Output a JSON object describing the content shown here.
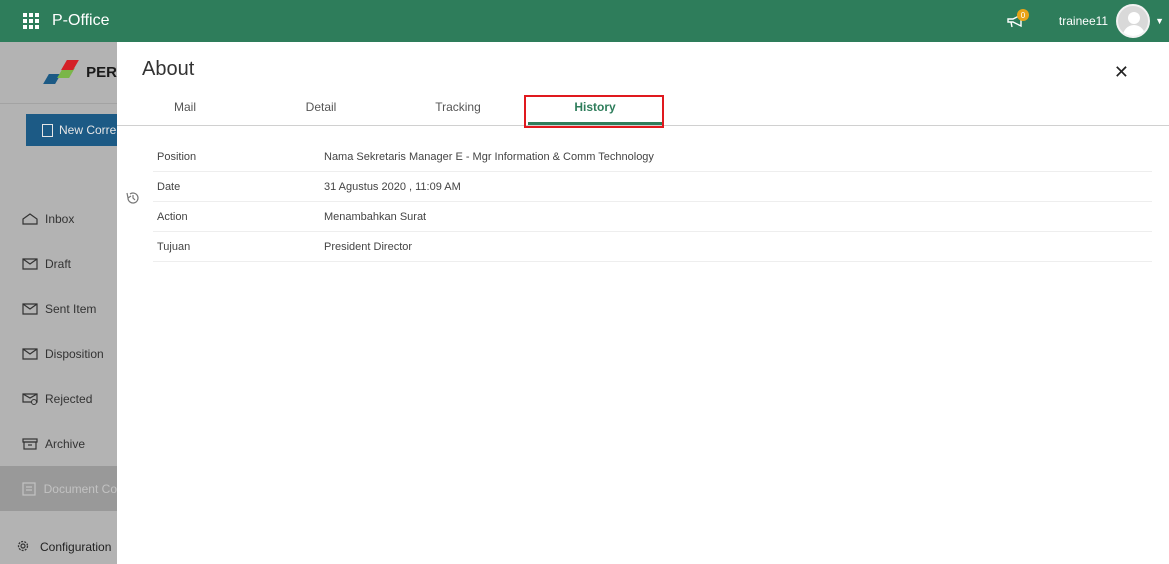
{
  "app": {
    "name": "P-Office"
  },
  "header": {
    "notification_count": "0",
    "username": "trainee11"
  },
  "sidebar": {
    "logo_text": "PER",
    "new_button_label": "New Corre",
    "items": [
      {
        "label": "Inbox",
        "icon": "inbox-icon"
      },
      {
        "label": "Draft",
        "icon": "draft-icon"
      },
      {
        "label": "Sent Item",
        "icon": "sent-icon"
      },
      {
        "label": "Disposition",
        "icon": "disposition-icon"
      },
      {
        "label": "Rejected",
        "icon": "rejected-icon"
      },
      {
        "label": "Archive",
        "icon": "archive-icon"
      },
      {
        "label": "Document Co",
        "icon": "document-icon",
        "active": true
      }
    ],
    "config_label": "Configuration"
  },
  "panel": {
    "title": "About",
    "tabs": [
      {
        "label": "Mail"
      },
      {
        "label": "Detail"
      },
      {
        "label": "Tracking"
      },
      {
        "label": "History",
        "active": true
      }
    ],
    "history": [
      {
        "label": "Position",
        "value": "Nama Sekretaris Manager E - Mgr Information & Comm Technology"
      },
      {
        "label": "Date",
        "value": "31 Agustus 2020 , 11:09 AM"
      },
      {
        "label": "Action",
        "value": "Menambahkan Surat"
      },
      {
        "label": "Tujuan",
        "value": "President Director"
      }
    ]
  },
  "colors": {
    "brand_green": "#2e7d5b",
    "highlight_red": "#e0191e",
    "new_button_blue": "#1c5a85"
  }
}
